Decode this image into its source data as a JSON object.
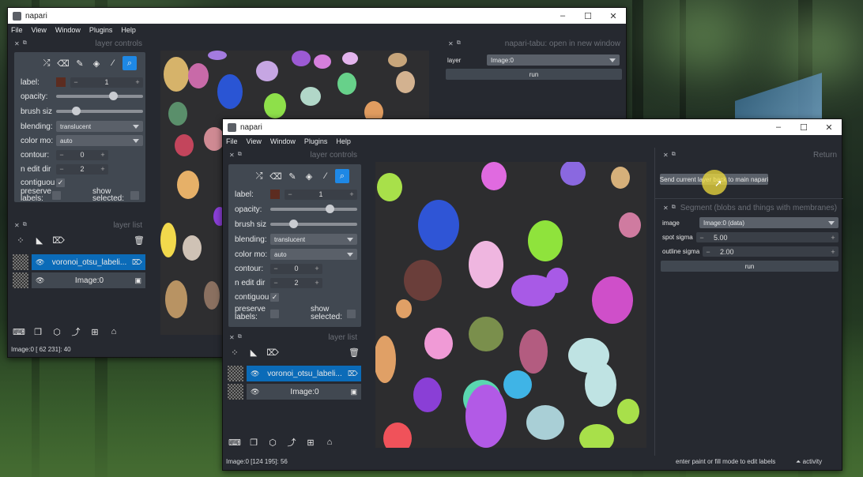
{
  "colors": {
    "accent": "#1e88e5",
    "selected_layer": "#0b6bb8",
    "panel": "#414851",
    "window": "#262930"
  },
  "back_window": {
    "title": "napari",
    "menu": [
      "File",
      "View",
      "Window",
      "Plugins",
      "Help"
    ],
    "layer_controls_title": "layer controls",
    "controls": {
      "label_label": "label:",
      "label_value": "1",
      "opacity_label": "opacity:",
      "opacity": 0.8,
      "brush_label": "brush siz",
      "brush": 0.2,
      "blending_label": "blending:",
      "blending_value": "translucent",
      "colormode_label": "color mo:",
      "colormode_value": "auto",
      "contour_label": "contour:",
      "contour_value": "0",
      "ndim_label": "n edit dir",
      "ndim_value": "2",
      "contiguous_label": "contiguou",
      "preserve_label": "preserve labels:",
      "show_selected_label": "show selected:"
    },
    "layer_list_title": "layer list",
    "layers": [
      {
        "name": "voronoi_otsu_labeli...",
        "selected": true
      },
      {
        "name": "Image:0",
        "selected": false
      }
    ],
    "tabu_dock_title": "napari-tabu: open in new window",
    "tabu_layer_label": "layer",
    "tabu_layer_value": "Image:0",
    "tabu_run_label": "run",
    "status": "Image:0 [ 62 231]: 40"
  },
  "front_window": {
    "title": "napari",
    "menu": [
      "File",
      "View",
      "Window",
      "Plugins",
      "Help"
    ],
    "layer_controls_title": "layer controls",
    "controls": {
      "label_label": "label:",
      "label_value": "1",
      "opacity_label": "opacity:",
      "opacity": 0.8,
      "brush_label": "brush siz",
      "brush": 0.2,
      "blending_label": "blending:",
      "blending_value": "translucent",
      "colormode_label": "color mo:",
      "colormode_value": "auto",
      "contour_label": "contour:",
      "contour_value": "0",
      "ndim_label": "n edit dir",
      "ndim_value": "2",
      "contiguous_label": "contiguou",
      "preserve_label": "preserve labels:",
      "show_selected_label": "show selected:"
    },
    "layer_list_title": "layer list",
    "layers": [
      {
        "name": "voronoi_otsu_labeli...",
        "selected": true
      },
      {
        "name": "Image:0",
        "selected": false
      }
    ],
    "return_dock_title": "Return",
    "send_button_label": "Send current layer back to main napari",
    "segment_dock_title": "Segment (blobs and things with membranes)",
    "image_label": "image",
    "image_value": "Image:0 (data)",
    "spot_sigma_label": "spot sigma",
    "spot_sigma_value": "5.00",
    "outline_sigma_label": "outline sigma",
    "outline_sigma_value": "2.00",
    "run_label": "run",
    "status": "Image:0 [124 195]: 56",
    "hint": "enter paint or fill mode to edit labels",
    "activity": "activity"
  }
}
